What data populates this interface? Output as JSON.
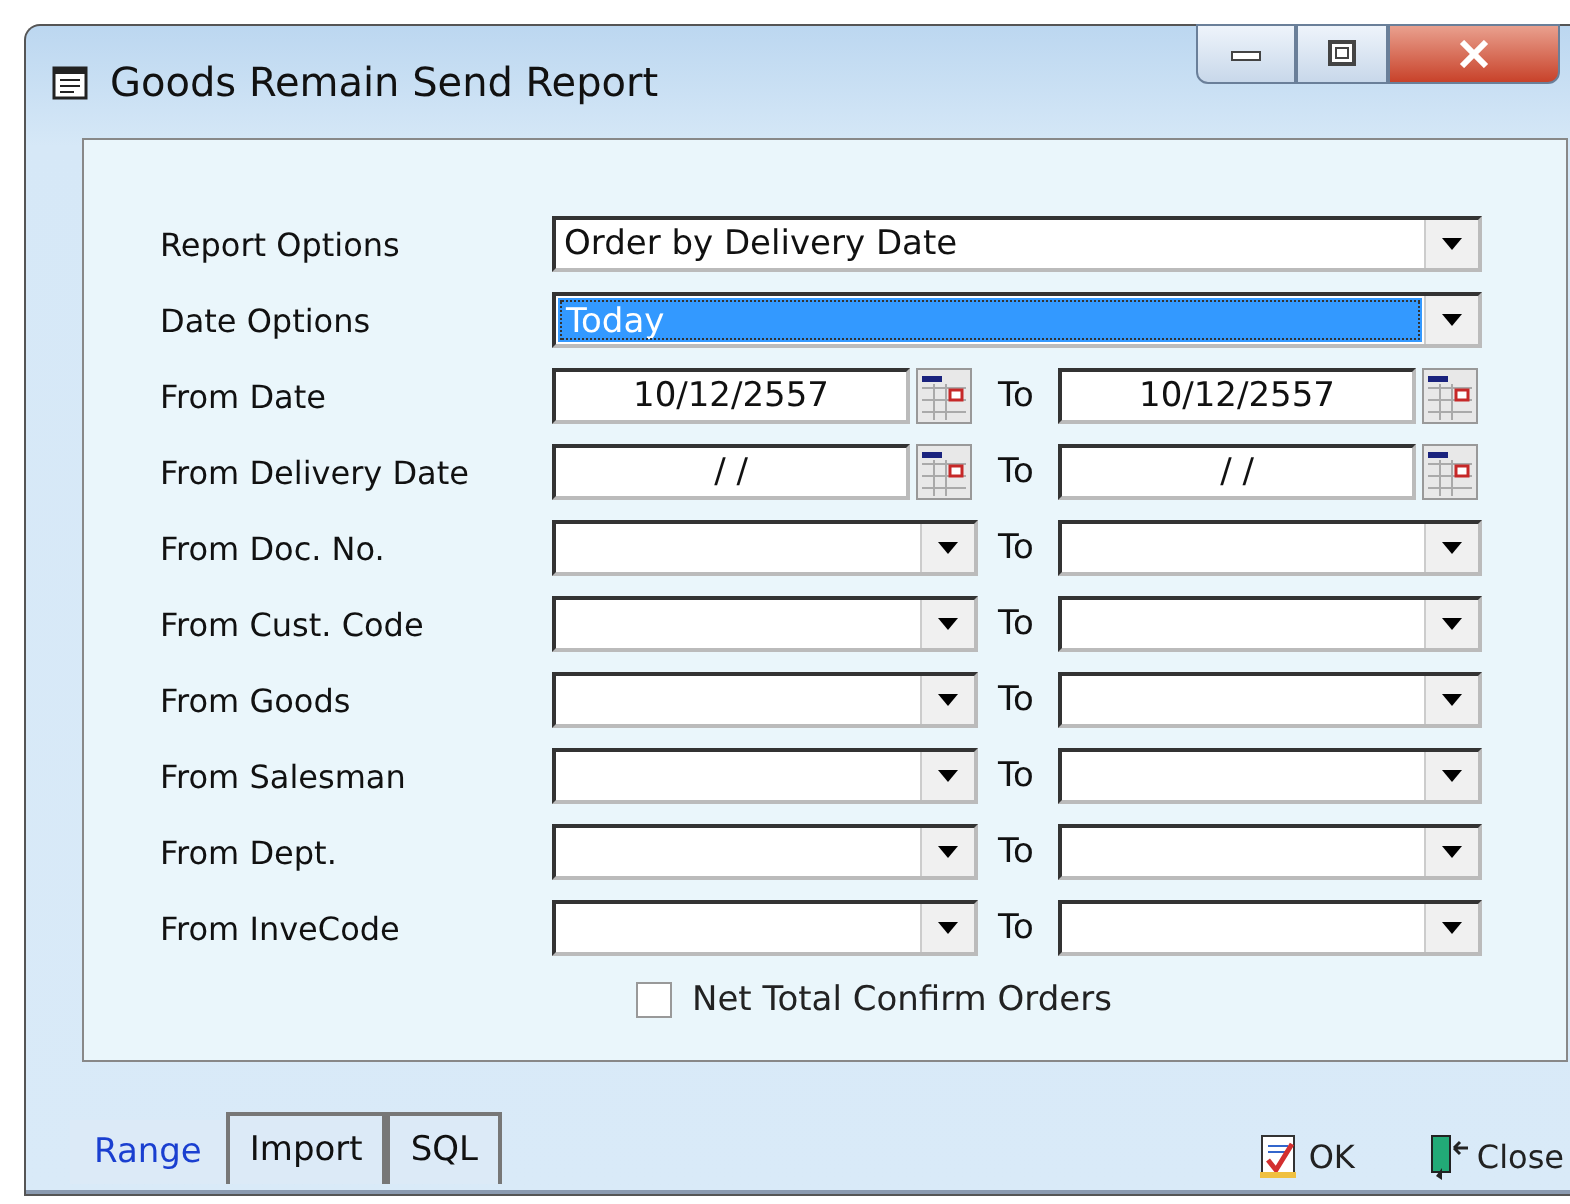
{
  "window": {
    "title": "Goods Remain Send Report"
  },
  "rows": [
    {
      "kind": "select",
      "label": "Report Options",
      "value": "Order by Delivery Date",
      "focused": false
    },
    {
      "kind": "select",
      "label": "Date Options",
      "value": "Today",
      "focused": true
    },
    {
      "kind": "date",
      "label": "From Date",
      "from": "10/12/2557",
      "to_label": "To",
      "to": "10/12/2557"
    },
    {
      "kind": "date",
      "label": "From Delivery Date",
      "from": "/ /",
      "to_label": "To",
      "to": "/ /"
    },
    {
      "kind": "combo",
      "label": "From Doc. No.",
      "to_label": "To"
    },
    {
      "kind": "combo",
      "label": "From Cust. Code",
      "to_label": "To"
    },
    {
      "kind": "combo",
      "label": "From Goods",
      "to_label": "To"
    },
    {
      "kind": "combo",
      "label": "From Salesman",
      "to_label": "To"
    },
    {
      "kind": "combo",
      "label": "From Dept.",
      "to_label": "To"
    },
    {
      "kind": "combo",
      "label": "From InveCode",
      "to_label": "To"
    }
  ],
  "checkbox": {
    "label": "Net Total Confirm Orders",
    "checked": false
  },
  "tabs": [
    {
      "label": "Range",
      "selected": true
    },
    {
      "label": "Import",
      "selected": false
    },
    {
      "label": "SQL",
      "selected": false
    }
  ],
  "buttons": [
    {
      "kind": "ok",
      "label": "OK"
    },
    {
      "kind": "close",
      "label": "Close"
    }
  ]
}
